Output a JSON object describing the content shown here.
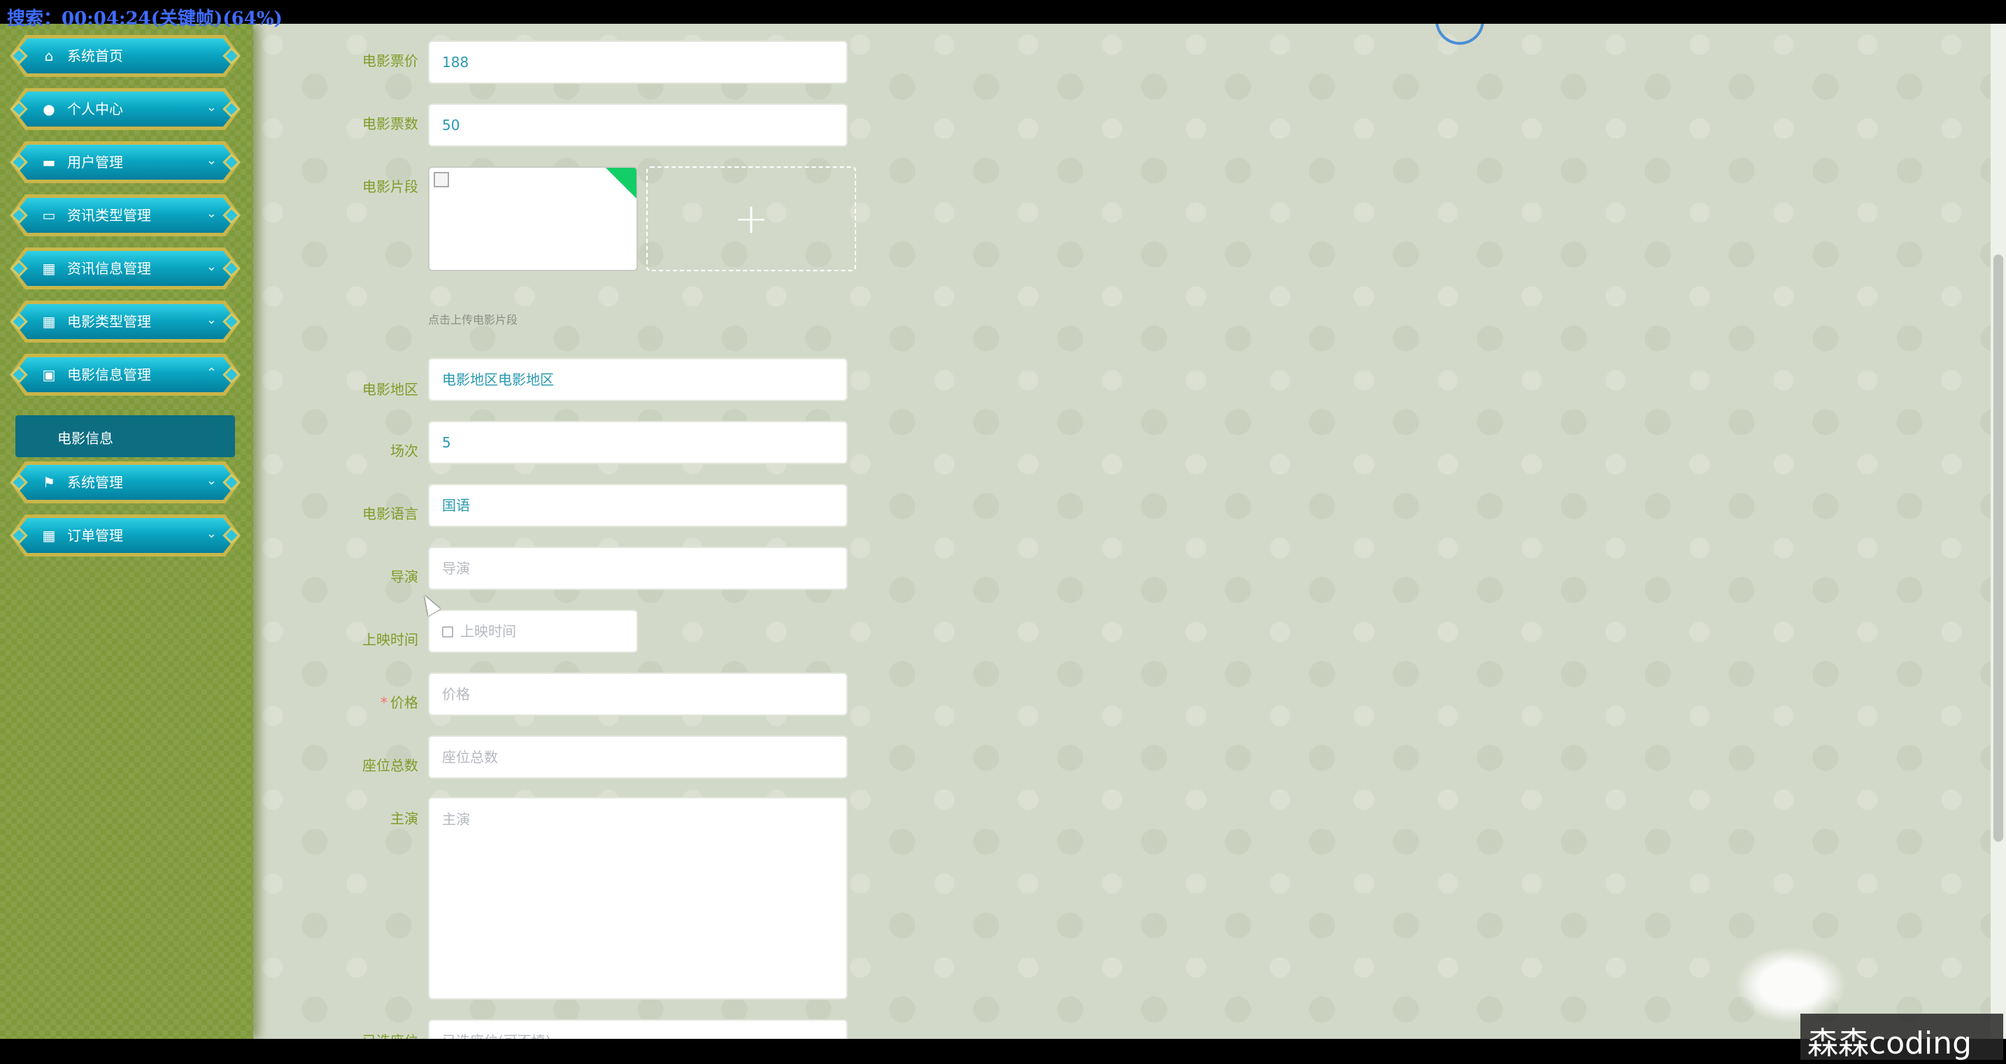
{
  "overlay": {
    "top_text": "搜索：00:04:24(关键帧)(64%)",
    "watermark": "森森coding"
  },
  "sidebar": {
    "items": [
      {
        "label": "系统首页",
        "icon": "home-icon",
        "expanded": false
      },
      {
        "label": "个人中心",
        "icon": "user-icon",
        "expanded": false
      },
      {
        "label": "用户管理",
        "icon": "briefcase-icon",
        "expanded": false
      },
      {
        "label": "资讯类型管理",
        "icon": "monitor-icon",
        "expanded": false
      },
      {
        "label": "资讯信息管理",
        "icon": "grid-icon",
        "expanded": false
      },
      {
        "label": "电影类型管理",
        "icon": "grid-icon",
        "expanded": false
      },
      {
        "label": "电影信息管理",
        "icon": "clipboard-icon",
        "expanded": true
      },
      {
        "label": "系统管理",
        "icon": "flag-icon",
        "expanded": false
      },
      {
        "label": "订单管理",
        "icon": "grid-icon",
        "expanded": false
      }
    ],
    "submenu": {
      "label": "电影信息",
      "active": true
    }
  },
  "form": {
    "ticket_price": {
      "label": "电影票价",
      "value": "188"
    },
    "ticket_count": {
      "label": "电影票数",
      "value": "50"
    },
    "clip": {
      "label": "电影片段",
      "tip": "点击上传电影片段",
      "add_symbol": "+"
    },
    "region": {
      "label": "电影地区",
      "value": "电影地区电影地区"
    },
    "sessions": {
      "label": "场次",
      "value": "5"
    },
    "language": {
      "label": "电影语言",
      "value": "国语"
    },
    "director": {
      "label": "导演",
      "placeholder": "导演"
    },
    "release_time": {
      "label": "上映时间",
      "placeholder": "上映时间"
    },
    "price": {
      "label": "价格",
      "placeholder": "价格",
      "required_mark": "*"
    },
    "total_seats": {
      "label": "座位总数",
      "placeholder": "座位总数"
    },
    "cast": {
      "label": "主演",
      "placeholder": "主演"
    },
    "cut_off_next": {
      "label": "已选座位",
      "placeholder": "已选座位(可不填)"
    }
  },
  "colors": {
    "label_green": "#7e9c2a",
    "menu_cyan": "#0aa6c2",
    "menu_gold": "#c9b64a",
    "submenu_teal": "#0d6e82",
    "sidebar_green": "#7f9a3b",
    "input_text": "#2a9ab0",
    "required_red": "#f56c6c"
  }
}
